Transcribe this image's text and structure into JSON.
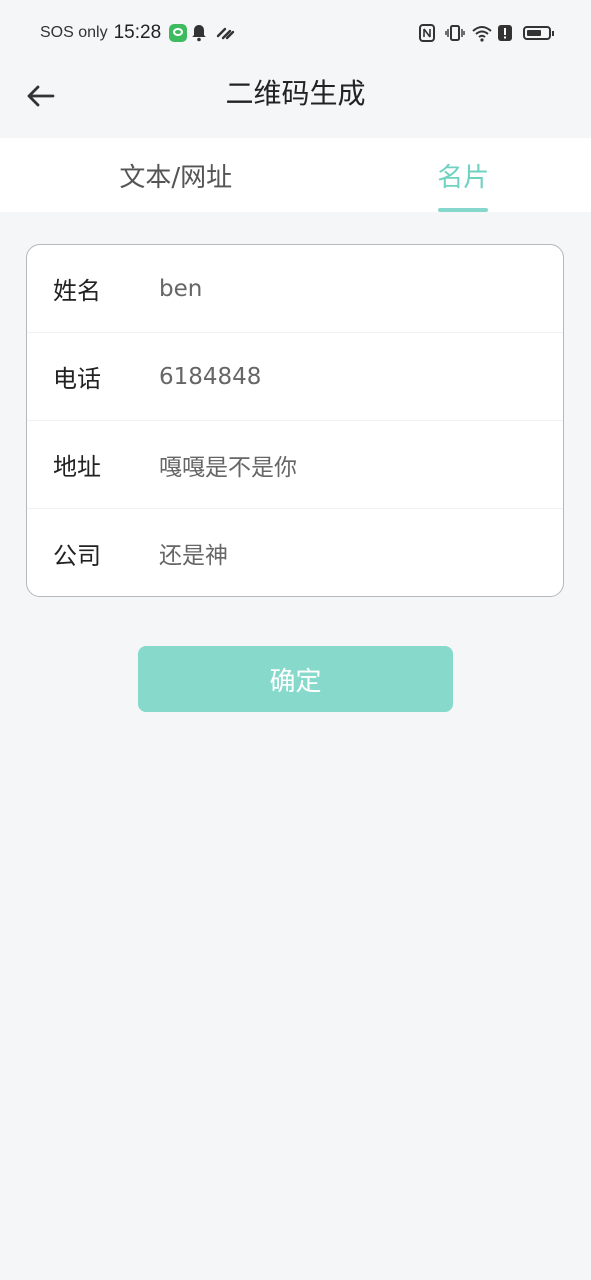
{
  "status_bar": {
    "carrier": "SOS only",
    "time": "15:28"
  },
  "header": {
    "title": "二维码生成"
  },
  "tabs": [
    {
      "label": "文本/网址",
      "active": false
    },
    {
      "label": "名片",
      "active": true
    }
  ],
  "form": {
    "fields": [
      {
        "label": "姓名",
        "value": "ben"
      },
      {
        "label": "电话",
        "value": "6184848"
      },
      {
        "label": "地址",
        "value": "嘎嘎是不是你"
      },
      {
        "label": "公司",
        "value": "还是神"
      }
    ]
  },
  "confirm_button": {
    "label": "确定"
  },
  "colors": {
    "accent": "#86d8cc",
    "accent_text": "#6fd2c1",
    "background": "#f5f6f8"
  }
}
